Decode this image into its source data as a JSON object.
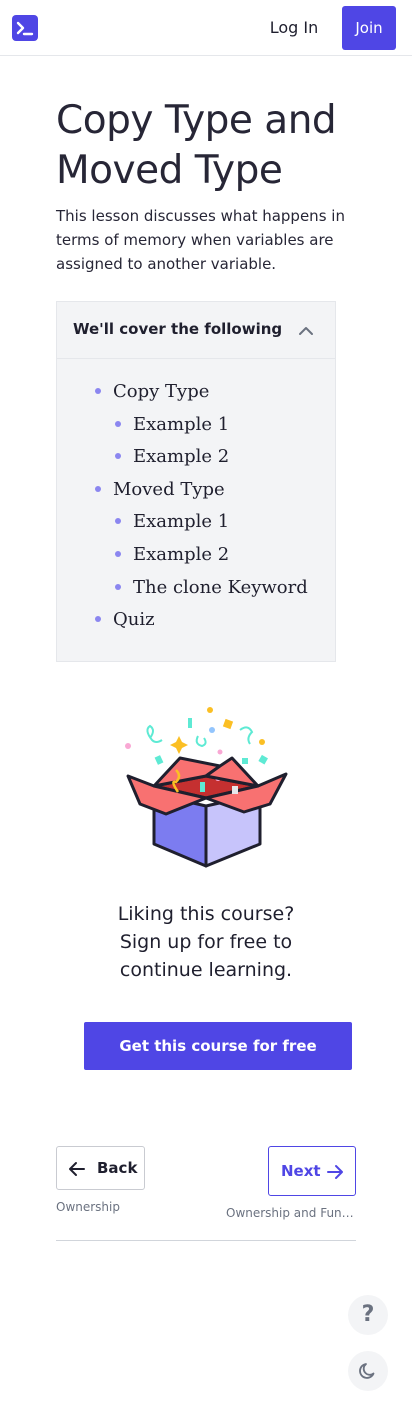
{
  "header": {
    "logo_icon": "terminal-icon",
    "login_label": "Log In",
    "join_label": "Join",
    "accent_color": "#4f46e5"
  },
  "lesson": {
    "title": "Copy Type and Moved Type",
    "description": "This lesson discusses what happens in terms of memory when variables are assigned to another variable."
  },
  "toc": {
    "heading": "We'll cover the following",
    "toggle_icon": "chevron-up-icon",
    "items": [
      {
        "label": "Copy Type",
        "level": 1
      },
      {
        "label": "Example 1",
        "level": 2
      },
      {
        "label": "Example 2",
        "level": 2
      },
      {
        "label": "Moved Type",
        "level": 1
      },
      {
        "label": "Example 1",
        "level": 2
      },
      {
        "label": "Example 2",
        "level": 2
      },
      {
        "label": "The clone Keyword",
        "level": 2
      },
      {
        "label": "Quiz",
        "level": 1
      }
    ]
  },
  "promo": {
    "illustration": "gift-box-confetti-illustration",
    "text": "Liking this course? Sign up for free to continue learning.",
    "cta_label": "Get this course for free"
  },
  "navigation": {
    "back_label": "Back",
    "back_subtitle": "Ownership",
    "next_label": "Next",
    "next_subtitle": "Ownership and Functi..."
  },
  "floating": {
    "help_label": "?",
    "help_icon": "help-icon",
    "theme_icon": "moon-icon"
  }
}
